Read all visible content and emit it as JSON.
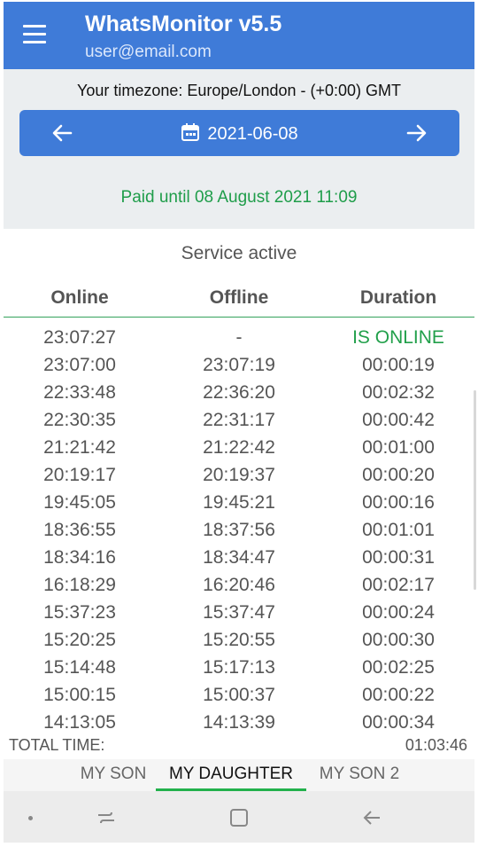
{
  "header": {
    "title": "WhatsMonitor v5.5",
    "subtitle": "user@email.com",
    "menu_icon": "hamburger-menu-icon",
    "bg_color": "#3f7bd8"
  },
  "timezone": "Your timezone: Europe/London  - (+0:00) GMT",
  "date_nav": {
    "date": "2021-06-08",
    "prev_icon": "arrow-left-icon",
    "next_icon": "arrow-right-icon",
    "calendar_icon": "calendar-icon"
  },
  "paid_until": "Paid until 08 August 2021 11:09",
  "service_status": "Service active",
  "table": {
    "headers": [
      "Online",
      "Offline",
      "Duration"
    ],
    "rows": [
      [
        "23:07:27",
        "-",
        "IS ONLINE"
      ],
      [
        "23:07:00",
        "23:07:19",
        "00:00:19"
      ],
      [
        "22:33:48",
        "22:36:20",
        "00:02:32"
      ],
      [
        "22:30:35",
        "22:31:17",
        "00:00:42"
      ],
      [
        "21:21:42",
        "21:22:42",
        "00:01:00"
      ],
      [
        "20:19:17",
        "20:19:37",
        "00:00:20"
      ],
      [
        "19:45:05",
        "19:45:21",
        "00:00:16"
      ],
      [
        "18:36:55",
        "18:37:56",
        "00:01:01"
      ],
      [
        "18:34:16",
        "18:34:47",
        "00:00:31"
      ],
      [
        "16:18:29",
        "16:20:46",
        "00:02:17"
      ],
      [
        "15:37:23",
        "15:37:47",
        "00:00:24"
      ],
      [
        "15:20:25",
        "15:20:55",
        "00:00:30"
      ],
      [
        "15:14:48",
        "15:17:13",
        "00:02:25"
      ],
      [
        "15:00:15",
        "15:00:37",
        "00:00:22"
      ],
      [
        "14:13:05",
        "14:13:39",
        "00:00:34"
      ]
    ]
  },
  "total": {
    "label": "TOTAL TIME:",
    "value": "01:03:46"
  },
  "tabs": [
    {
      "label": "MY SON",
      "active": false
    },
    {
      "label": "MY DAUGHTER",
      "active": true
    },
    {
      "label": "MY SON 2",
      "active": false
    }
  ],
  "colors": {
    "accent": "#3f7bd8",
    "online_green": "#22a04b",
    "tab_indicator": "#22b14c"
  }
}
